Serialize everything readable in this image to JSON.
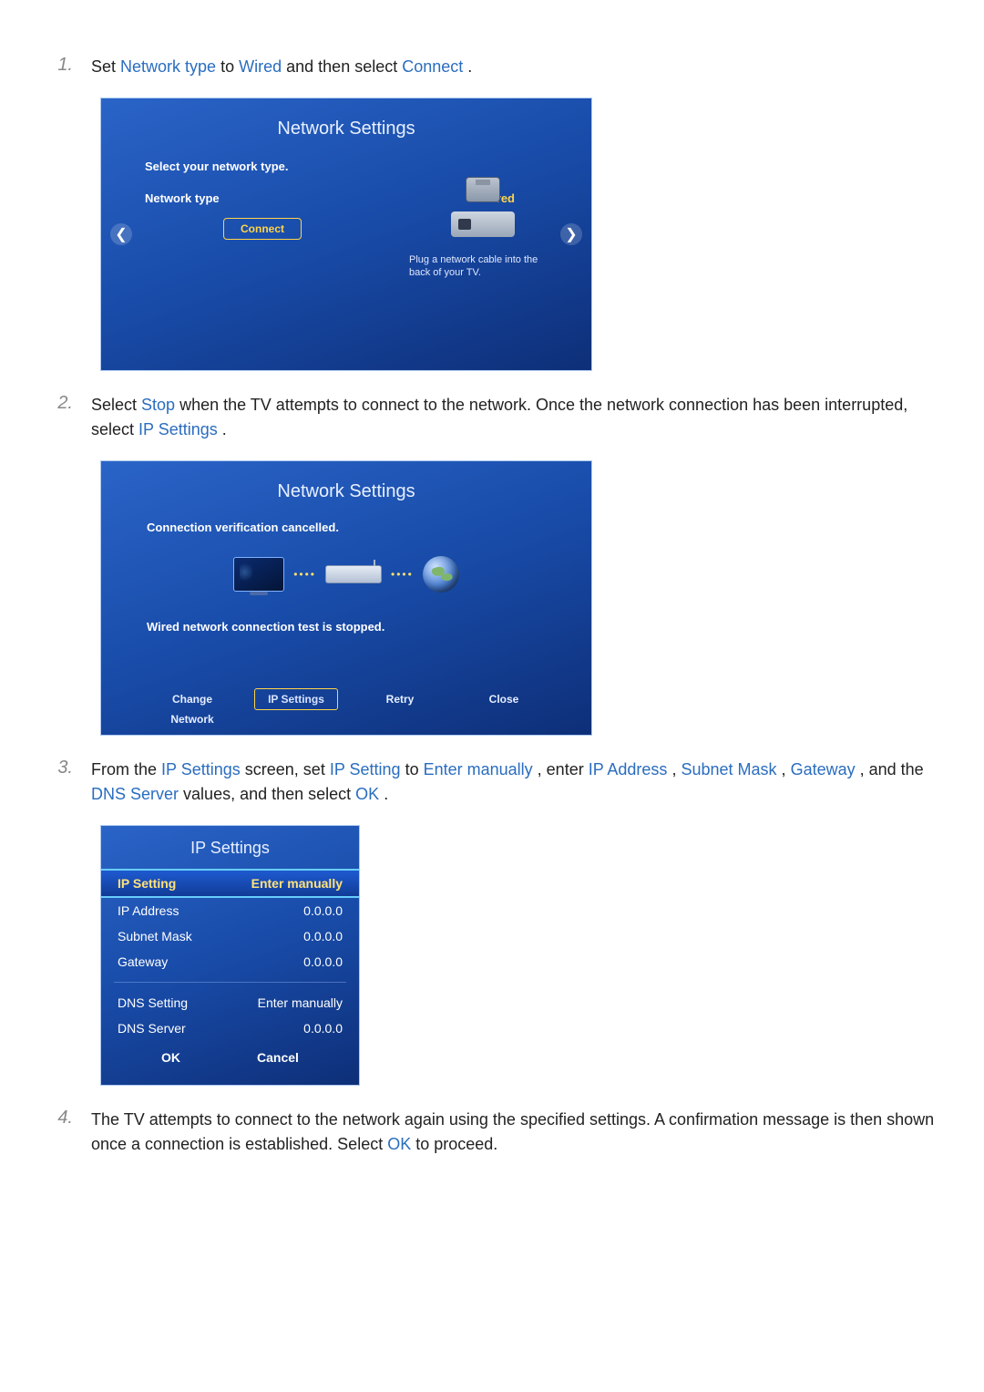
{
  "steps": {
    "s1": {
      "num": "1.",
      "pre": "Set ",
      "hl1": "Network type",
      "mid": " to ",
      "hl2": "Wired",
      "post1": " and then select ",
      "hl3": "Connect",
      "post2": "."
    },
    "s2": {
      "num": "2.",
      "pre": "Select ",
      "hl1": "Stop",
      "mid1": " when the TV attempts to connect to the network. Once the network connection has been interrupted, select ",
      "hl2": "IP Settings",
      "post": "."
    },
    "s3": {
      "num": "3.",
      "pre": "From the ",
      "hl1": "IP Settings",
      "t1": " screen, set ",
      "hl2": "IP Setting",
      "t2": " to ",
      "hl3": "Enter manually",
      "t3": ", enter ",
      "hl4": "IP Address",
      "t4": ", ",
      "hl5": "Subnet Mask",
      "t5": ", ",
      "hl6": "Gateway",
      "t6": ", and the ",
      "hl7": "DNS Server",
      "t7": " values, and then select ",
      "hl8": "OK",
      "t8": "."
    },
    "s4": {
      "num": "4.",
      "pre": "The TV attempts to connect to the network again using the specified settings. A confirmation message is then shown once a connection is established. Select ",
      "hl1": "OK",
      "post": " to proceed."
    }
  },
  "panel1": {
    "title": "Network Settings",
    "selectText": "Select your network type.",
    "row_label": "Network type",
    "row_value": "Wired",
    "connect": "Connect",
    "hint": "Plug a network cable into the back of your TV."
  },
  "panel2": {
    "title": "Network Settings",
    "msg": "Connection verification cancelled.",
    "status": "Wired network connection test is stopped.",
    "buttons": {
      "change": "Change Network",
      "ip": "IP Settings",
      "retry": "Retry",
      "close": "Close"
    }
  },
  "panel3": {
    "title": "IP Settings",
    "rows": {
      "ip_setting_label": "IP Setting",
      "ip_setting_val": "Enter manually",
      "ip_addr_label": "IP Address",
      "ip_addr_val": "0.0.0.0",
      "subnet_label": "Subnet Mask",
      "subnet_val": "0.0.0.0",
      "gateway_label": "Gateway",
      "gateway_val": "0.0.0.0",
      "dns_setting_label": "DNS Setting",
      "dns_setting_val": "Enter manually",
      "dns_server_label": "DNS Server",
      "dns_server_val": "0.0.0.0"
    },
    "ok": "OK",
    "cancel": "Cancel"
  }
}
